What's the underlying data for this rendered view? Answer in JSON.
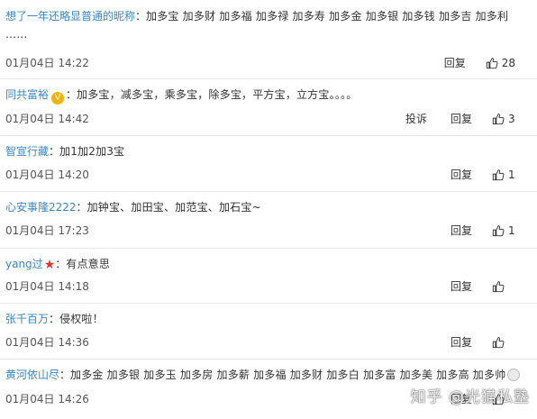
{
  "comments": [
    {
      "user": "想了一年还略显普通的昵称",
      "text": "加多宝 加多财 加多福 加多禄 加多寿 加多金 加多银 加多钱 加多吉 加多利 ……",
      "time": "01月04日 14:22",
      "report": "",
      "reply": "回复",
      "likes": "28"
    },
    {
      "user": "同共富裕",
      "badge": "V",
      "text": "加多宝，减多宝，乘多宝，除多宝，平方宝，立方宝。。。。",
      "time": "01月04日 14:42",
      "report": "投诉",
      "reply": "回复",
      "likes": "3"
    },
    {
      "user": "智宣行藏",
      "text": "加1加2加3宝",
      "time": "01月04日 14:20",
      "report": "",
      "reply": "回复",
      "likes": "1"
    },
    {
      "user": "心安事隆2222",
      "text": "加钟宝、加田宝、加范宝、加石宝~",
      "time": "01月04日 17:23",
      "report": "",
      "reply": "回复",
      "likes": "1"
    },
    {
      "user": "yang过",
      "text": "有点意思",
      "time": "01月04日 14:18",
      "report": "",
      "reply": "回复",
      "likes": ""
    },
    {
      "user": "张千百万",
      "text": "侵权啦！",
      "time": "01月04日 14:36",
      "report": "",
      "reply": "回复",
      "likes": ""
    },
    {
      "user": "黄河依山尽",
      "text": "加多金 加多银 加多玉 加多房 加多薪 加多福 加多财 加多白 加多富 加多美 加多高 加多帅",
      "time": "01月04日 14:26",
      "report": "",
      "reply": "回复",
      "likes": ""
    }
  ],
  "separator": "：",
  "watermark": "知乎 @光猫私塾",
  "colors": {
    "username": "#3a86c7",
    "badge": "#f5b300",
    "star": "#e8332c",
    "divider": "#e8e8e8"
  }
}
